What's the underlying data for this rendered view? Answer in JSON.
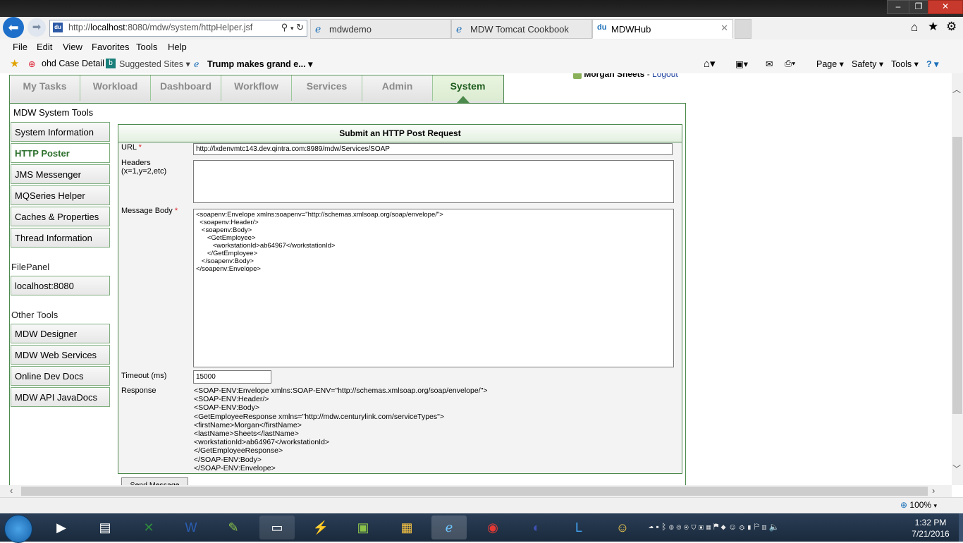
{
  "browser": {
    "window_buttons": {
      "minimize": "–",
      "maximize": "❐",
      "close": "✕"
    },
    "address": {
      "prefix": "http://",
      "host": "localhost",
      "rest": ":8080/mdw/system/httpHelper.jsf"
    },
    "tabs": [
      {
        "label": "mdwdemo",
        "active": false
      },
      {
        "label": "MDW Tomcat Cookbook",
        "active": false
      },
      {
        "label": "MDWHub",
        "active": true
      }
    ],
    "menus": [
      "File",
      "Edit",
      "View",
      "Favorites",
      "Tools",
      "Help"
    ],
    "favorites": [
      {
        "label": "ohd Case Detail"
      },
      {
        "label": "Suggested Sites ▾"
      },
      {
        "label": "Trump makes grand e... ▾"
      }
    ],
    "commands": {
      "page": "Page ▾",
      "safety": "Safety ▾",
      "tools": "Tools ▾",
      "help": "? ▾"
    },
    "zoom": "100%"
  },
  "app": {
    "tabs": [
      "My Tasks",
      "Workload",
      "Dashboard",
      "Workflow",
      "Services",
      "Admin",
      "System"
    ],
    "active_tab": "System",
    "user": {
      "name": "Morgan Sheets",
      "logout": "Logout"
    },
    "panel_title": "MDW System Tools",
    "sidebar": {
      "tools": [
        "System Information",
        "HTTP Poster",
        "JMS Messenger",
        "MQSeries Helper",
        "Caches & Properties",
        "Thread Information"
      ],
      "active": "HTTP Poster",
      "filepanel_heading": "FilePanel",
      "filepanel": [
        "localhost:8080"
      ],
      "other_heading": "Other Tools",
      "other": [
        "MDW Designer",
        "MDW Web Services",
        "Online Dev Docs",
        "MDW API JavaDocs"
      ]
    },
    "form": {
      "title": "Submit an HTTP Post Request",
      "url_label": "URL",
      "url_value": "http://lxdenvmtc143.dev.qintra.com:8989/mdw/Services/SOAP",
      "headers_label": "Headers",
      "headers_hint": "(x=1,y=2,etc)",
      "headers_value": "",
      "body_label": "Message Body",
      "body_value": "<soapenv:Envelope xmlns:soapenv=\"http://schemas.xmlsoap.org/soap/envelope/\">\n  <soapenv:Header/>\n   <soapenv:Body>\n      <GetEmployee>\n         <workstationId>ab64967</workstationId>\n      </GetEmployee>\n   </soapenv:Body>\n</soapenv:Envelope>",
      "timeout_label": "Timeout (ms)",
      "timeout_value": "15000",
      "response_label": "Response",
      "response_value": "<SOAP-ENV:Envelope xmlns:SOAP-ENV=\"http://schemas.xmlsoap.org/soap/envelope/\">\n<SOAP-ENV:Header/>\n<SOAP-ENV:Body>\n<GetEmployeeResponse xmlns=\"http://mdw.centurylink.com/serviceTypes\">\n<firstName>Morgan</firstName>\n<lastName>Sheets</lastName>\n<workstationId>ab64967</workstationId>\n</GetEmployeeResponse>\n</SOAP-ENV:Body>\n</SOAP-ENV:Envelope>",
      "send_label": "Send Message"
    }
  },
  "taskbar": {
    "time": "1:32 PM",
    "date": "7/21/2016"
  }
}
